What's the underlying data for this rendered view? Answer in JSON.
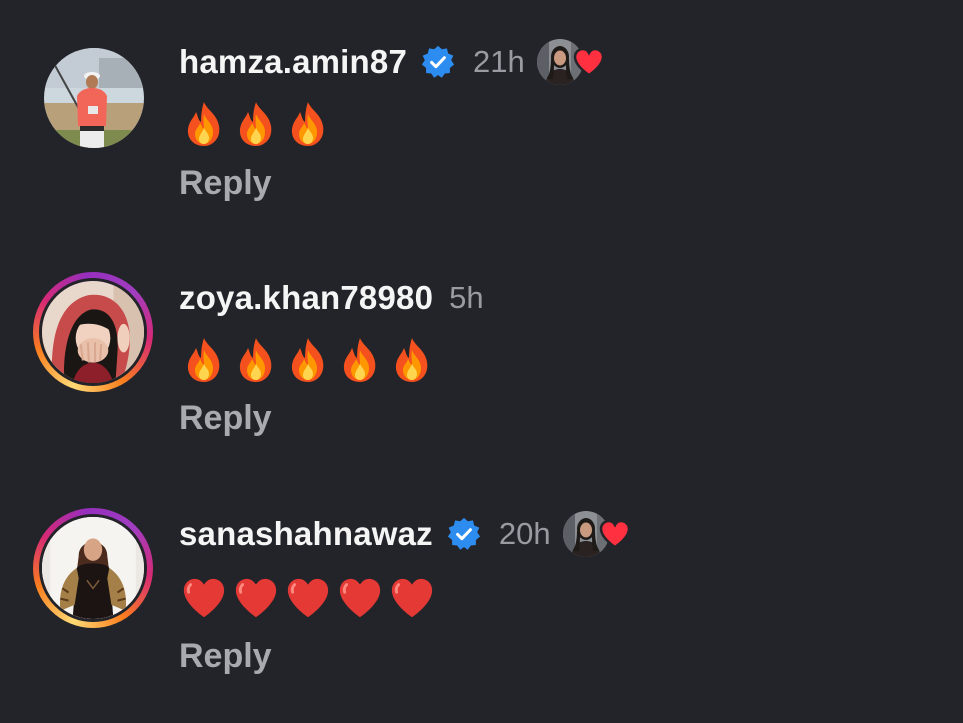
{
  "comments": [
    {
      "username": "hamza.amin87",
      "verified": true,
      "time": "21h",
      "liked_by_author": true,
      "avatar": "man-golfer-avatar",
      "ring": false,
      "emojis": [
        "fire",
        "fire",
        "fire"
      ],
      "reply_label": "Reply"
    },
    {
      "username": "zoya.khan78980",
      "verified": false,
      "time": "5h",
      "liked_by_author": false,
      "avatar": "woman-red-scarf-avatar",
      "ring": true,
      "emojis": [
        "fire",
        "fire",
        "fire",
        "fire",
        "fire"
      ],
      "reply_label": "Reply"
    },
    {
      "username": "sanashahnawaz",
      "verified": true,
      "time": "20h",
      "liked_by_author": true,
      "avatar": "woman-black-dress-avatar",
      "ring": true,
      "emojis": [
        "red-heart",
        "red-heart",
        "red-heart",
        "red-heart",
        "red-heart"
      ],
      "reply_label": "Reply"
    }
  ],
  "colors": {
    "background": "#232429",
    "username": "#f5f5f5",
    "timestamp": "#9a9ba2",
    "reply": "#a9aab0",
    "verified_badge": "#2d8cf0",
    "like_heart": "#ff3040"
  }
}
